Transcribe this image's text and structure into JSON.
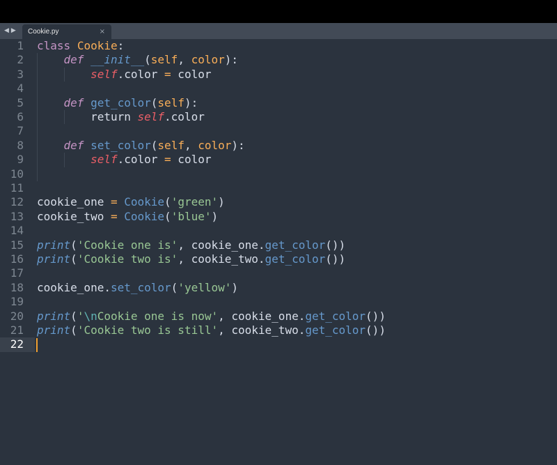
{
  "tab": {
    "title": "Cookie.py",
    "close_glyph": "×"
  },
  "nav": {
    "back": "◀",
    "forward": "▶"
  },
  "active_line": 22,
  "line_numbers": [
    "1",
    "2",
    "3",
    "4",
    "5",
    "6",
    "7",
    "8",
    "9",
    "10",
    "11",
    "12",
    "13",
    "14",
    "15",
    "16",
    "17",
    "18",
    "19",
    "20",
    "21",
    "22"
  ],
  "code": {
    "l1": {
      "kw": "class",
      "name": "Cookie",
      "colon": ":"
    },
    "l2": {
      "kw": "def",
      "name": "__init__",
      "open": "(",
      "p1": "self",
      "sep": ", ",
      "p2": "color",
      "close": "):"
    },
    "l3": {
      "self": "self",
      "rest": ".color ",
      "eq": "=",
      "tail": " color"
    },
    "l5": {
      "kw": "def",
      "name": "get_color",
      "open": "(",
      "p1": "self",
      "close": "):"
    },
    "l6": {
      "ret": "return ",
      "self": "self",
      "rest": ".color"
    },
    "l8": {
      "kw": "def",
      "name": "set_color",
      "open": "(",
      "p1": "self",
      "sep": ", ",
      "p2": "color",
      "close": "):"
    },
    "l9": {
      "self": "self",
      "rest": ".color ",
      "eq": "=",
      "tail": " color"
    },
    "l12": {
      "var": "cookie_one ",
      "eq": "=",
      "sp": " ",
      "cls": "Cookie",
      "open": "(",
      "str": "'green'",
      "close": ")"
    },
    "l13": {
      "var": "cookie_two ",
      "eq": "=",
      "sp": " ",
      "cls": "Cookie",
      "open": "(",
      "str": "'blue'",
      "close": ")"
    },
    "l15": {
      "fn": "print",
      "open": "(",
      "str": "'Cookie one is'",
      "mid": ", cookie_one.",
      "call": "get_color",
      "close": "())"
    },
    "l16": {
      "fn": "print",
      "open": "(",
      "str": "'Cookie two is'",
      "mid": ", cookie_two.",
      "call": "get_color",
      "close": "())"
    },
    "l18": {
      "pre": "cookie_one.",
      "call": "set_color",
      "open": "(",
      "str": "'yellow'",
      "close": ")"
    },
    "l20": {
      "fn": "print",
      "open": "(",
      "q": "'",
      "esc": "\\n",
      "str": "Cookie one is now'",
      "mid": ", cookie_one.",
      "call": "get_color",
      "close": "())"
    },
    "l21": {
      "fn": "print",
      "open": "(",
      "str": "'Cookie two is still'",
      "mid": ", cookie_two.",
      "call": "get_color",
      "close": "())"
    }
  },
  "colors": {
    "background": "#2b333e",
    "tabbar": "#424a56",
    "keyword": "#c594c5",
    "class_name": "#f9ae58",
    "function": "#6699cc",
    "self": "#ec5f67",
    "string": "#99c794",
    "escape": "#5fb3b3",
    "plain": "#d8dee9",
    "caret": "#f0a030"
  }
}
